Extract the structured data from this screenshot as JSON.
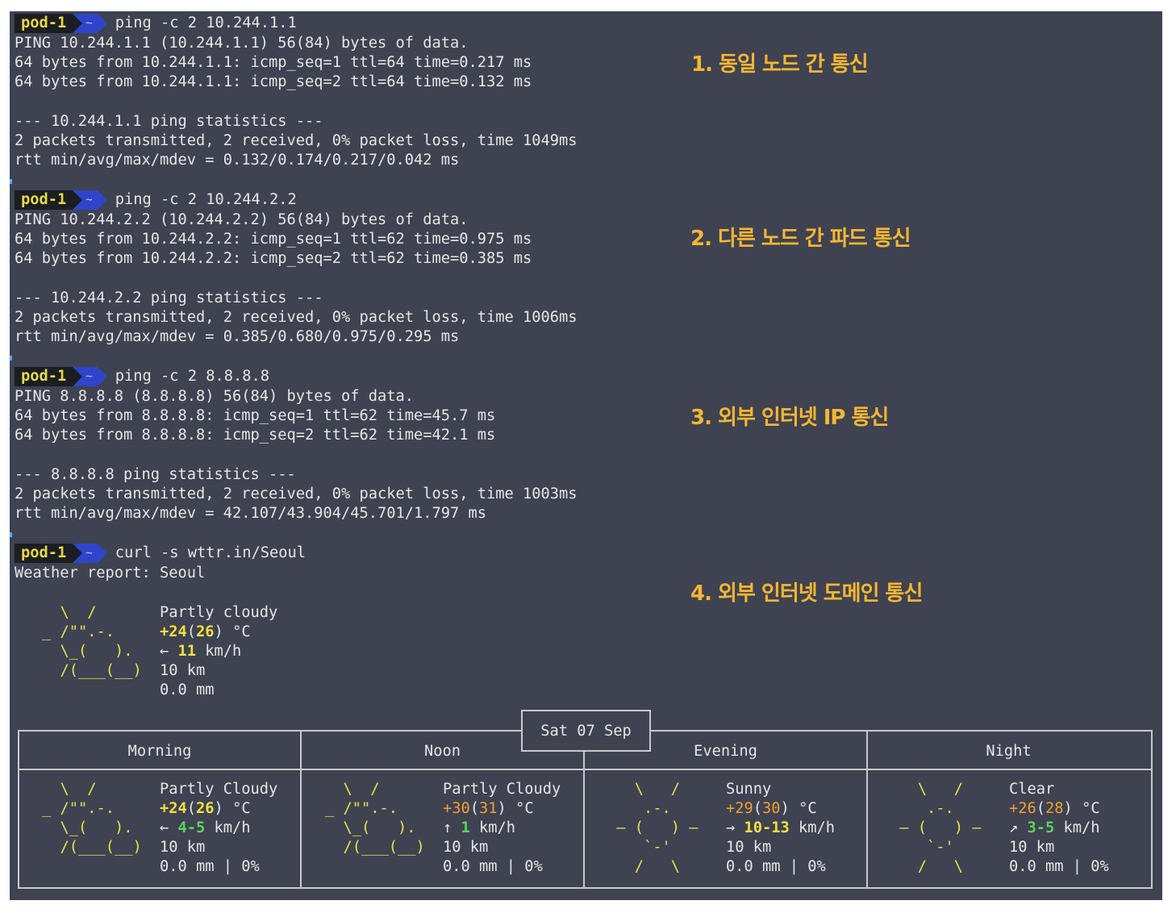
{
  "prompt": {
    "pod": "pod-1",
    "dir": "~"
  },
  "blocks": [
    {
      "command": "ping -c 2 10.244.1.1",
      "output": [
        "PING 10.244.1.1 (10.244.1.1) 56(84) bytes of data.",
        "64 bytes from 10.244.1.1: icmp_seq=1 ttl=64 time=0.217 ms",
        "64 bytes from 10.244.1.1: icmp_seq=2 ttl=64 time=0.132 ms",
        "",
        "--- 10.244.1.1 ping statistics ---",
        "2 packets transmitted, 2 received, 0% packet loss, time 1049ms",
        "rtt min/avg/max/mdev = 0.132/0.174/0.217/0.042 ms"
      ],
      "annotation": "1. 동일 노드 간 통신"
    },
    {
      "command": "ping -c 2 10.244.2.2",
      "output": [
        "PING 10.244.2.2 (10.244.2.2) 56(84) bytes of data.",
        "64 bytes from 10.244.2.2: icmp_seq=1 ttl=62 time=0.975 ms",
        "64 bytes from 10.244.2.2: icmp_seq=2 ttl=62 time=0.385 ms",
        "",
        "--- 10.244.2.2 ping statistics ---",
        "2 packets transmitted, 2 received, 0% packet loss, time 1006ms",
        "rtt min/avg/max/mdev = 0.385/0.680/0.975/0.295 ms"
      ],
      "annotation": "2. 다른 노드 간 파드 통신"
    },
    {
      "command": "ping -c 2 8.8.8.8",
      "output": [
        "PING 8.8.8.8 (8.8.8.8) 56(84) bytes of data.",
        "64 bytes from 8.8.8.8: icmp_seq=1 ttl=62 time=45.7 ms",
        "64 bytes from 8.8.8.8: icmp_seq=2 ttl=62 time=42.1 ms",
        "",
        "--- 8.8.8.8 ping statistics ---",
        "2 packets transmitted, 2 received, 0% packet loss, time 1003ms",
        "rtt min/avg/max/mdev = 42.107/43.904/45.701/1.797 ms"
      ],
      "annotation": "3. 외부 인터넷 IP 통신"
    },
    {
      "command": "curl -s wttr.in/Seoul",
      "output": [
        "Weather report: Seoul"
      ],
      "annotation": "4. 외부 인터넷 도메인 통신"
    }
  ],
  "current": {
    "art": [
      "  \\  /",
      "_ /\"\".-.",
      "  \\_(   ).",
      "  /(___(__)"
    ],
    "condition": "Partly cloudy",
    "temp": "+24",
    "feels": "26",
    "temp_unit": " °C",
    "wind_arrow": "←",
    "wind": "11",
    "wind_unit": " km/h",
    "visibility": "10 km",
    "precip": "0.0 mm"
  },
  "forecast": {
    "date": "Sat 07 Sep",
    "periods": [
      {
        "name": "Morning",
        "art": [
          "  \\  /",
          "_ /\"\".-.",
          "  \\_(   ).",
          "  /(___(__)"
        ],
        "condition": "Partly Cloudy",
        "temp": "+24",
        "feels": "26",
        "temp_unit": " °C",
        "wind_arrow": "←",
        "wind": "4-5",
        "wind_unit": " km/h",
        "visibility": "10 km",
        "precip": "0.0 mm | 0%"
      },
      {
        "name": "Noon",
        "art": [
          "  \\  /",
          "_ /\"\".-.",
          "  \\_(   ).",
          "  /(___(__)"
        ],
        "condition": "Partly Cloudy",
        "temp": "+30",
        "feels": "31",
        "temp_unit": " °C",
        "wind_arrow": "↑",
        "wind": "1",
        "wind_unit": " km/h",
        "visibility": "10 km",
        "precip": "0.0 mm | 0%"
      },
      {
        "name": "Evening",
        "art": [
          "   \\   /",
          "    .-.",
          " ― (   ) ―",
          "    `-'",
          "   /   \\"
        ],
        "condition": "Sunny",
        "temp": "+29",
        "feels": "30",
        "temp_unit": " °C",
        "wind_arrow": "→",
        "wind": "10-13",
        "wind_unit": " km/h",
        "visibility": "10 km",
        "precip": "0.0 mm | 0%"
      },
      {
        "name": "Night",
        "art": [
          "   \\   /",
          "    .-.",
          " ― (   ) ―",
          "    `-'",
          "   /   \\"
        ],
        "condition": "Clear",
        "temp": "+26",
        "feels": "28",
        "temp_unit": " °C",
        "wind_arrow": "↗",
        "wind": "3-5",
        "wind_unit": " km/h",
        "visibility": "10 km",
        "precip": "0.0 mm | 0%"
      }
    ]
  }
}
